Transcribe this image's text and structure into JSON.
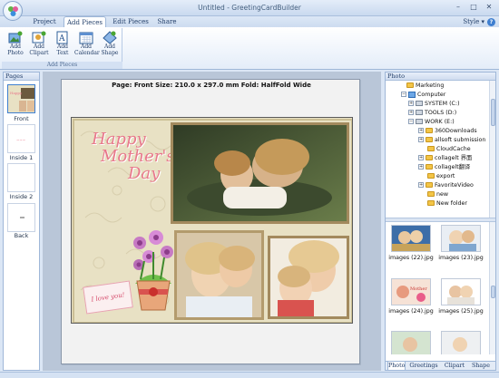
{
  "window": {
    "title": "Untitled - GreetingCardBuilder",
    "minimize_glyph": "–",
    "maximize_glyph": "□",
    "close_glyph": "✕"
  },
  "tabs": [
    {
      "label": "Project",
      "active": false
    },
    {
      "label": "Add Pieces",
      "active": true
    },
    {
      "label": "Edit Pieces",
      "active": false
    },
    {
      "label": "Share",
      "active": false
    }
  ],
  "style_menu": "Style ▾",
  "help_glyph": "?",
  "ribbon": {
    "group_label": "Add Pieces",
    "buttons": [
      {
        "line1": "Add",
        "line2": "Photo",
        "icon": "add-photo-icon"
      },
      {
        "line1": "Add",
        "line2": "Clipart",
        "icon": "add-clipart-icon"
      },
      {
        "line1": "Add",
        "line2": "Text",
        "icon": "add-text-icon"
      },
      {
        "line1": "Add",
        "line2": "Calendar",
        "icon": "add-calendar-icon"
      },
      {
        "line1": "Add",
        "line2": "Shape",
        "icon": "add-shape-icon"
      }
    ]
  },
  "pages_panel": {
    "title": "Pages",
    "pages": [
      {
        "label": "Front",
        "selected": true
      },
      {
        "label": "Inside 1",
        "selected": false
      },
      {
        "label": "Inside 2",
        "selected": false
      },
      {
        "label": "Back",
        "selected": false
      }
    ]
  },
  "canvas": {
    "page_info": "Page: Front   Size: 210.0 x 297.0 mm   Fold: HalfFold Wide"
  },
  "card": {
    "title_lines": [
      "Happy",
      "Mother's",
      "Day"
    ],
    "tag_text": "I love you!",
    "colors": {
      "title": "#e8788b",
      "background": "#e8e1c4",
      "frame": "#a38a5e"
    }
  },
  "photo_panel": {
    "title": "Photo",
    "tree": [
      {
        "label": "Marketing",
        "level": 1,
        "expander": "",
        "icon": "folder"
      },
      {
        "label": "Computer",
        "level": 1,
        "expander": "−",
        "icon": "computer"
      },
      {
        "label": "SYSTEM (C:)",
        "level": 2,
        "expander": "+",
        "icon": "drive"
      },
      {
        "label": "TOOLS (D:)",
        "level": 2,
        "expander": "+",
        "icon": "drive"
      },
      {
        "label": "WORK (E:)",
        "level": 2,
        "expander": "−",
        "icon": "drive"
      },
      {
        "label": "360Downloads",
        "level": 3,
        "expander": "+",
        "icon": "folder"
      },
      {
        "label": "allsoft submission",
        "level": 3,
        "expander": "+",
        "icon": "folder"
      },
      {
        "label": "CloudCache",
        "level": 3,
        "expander": "",
        "icon": "folder"
      },
      {
        "label": "collagelt 界面",
        "level": 3,
        "expander": "+",
        "icon": "folder"
      },
      {
        "label": "collagelt翻译",
        "level": 3,
        "expander": "+",
        "icon": "folder"
      },
      {
        "label": "export",
        "level": 3,
        "expander": "",
        "icon": "folder"
      },
      {
        "label": "FavoriteVideo",
        "level": 3,
        "expander": "+",
        "icon": "folder"
      },
      {
        "label": "new",
        "level": 3,
        "expander": "",
        "icon": "folder"
      },
      {
        "label": "New folder",
        "level": 3,
        "expander": "",
        "icon": "folder"
      }
    ],
    "photos": [
      {
        "name": "images (22).jpg"
      },
      {
        "name": "images (23).jpg"
      },
      {
        "name": "images (24).jpg"
      },
      {
        "name": "images (25).jpg"
      }
    ],
    "bottom_tabs": [
      {
        "label": "Photo",
        "active": true
      },
      {
        "label": "Greetings",
        "active": false
      },
      {
        "label": "Clipart",
        "active": false
      },
      {
        "label": "Shape",
        "active": false
      }
    ]
  }
}
